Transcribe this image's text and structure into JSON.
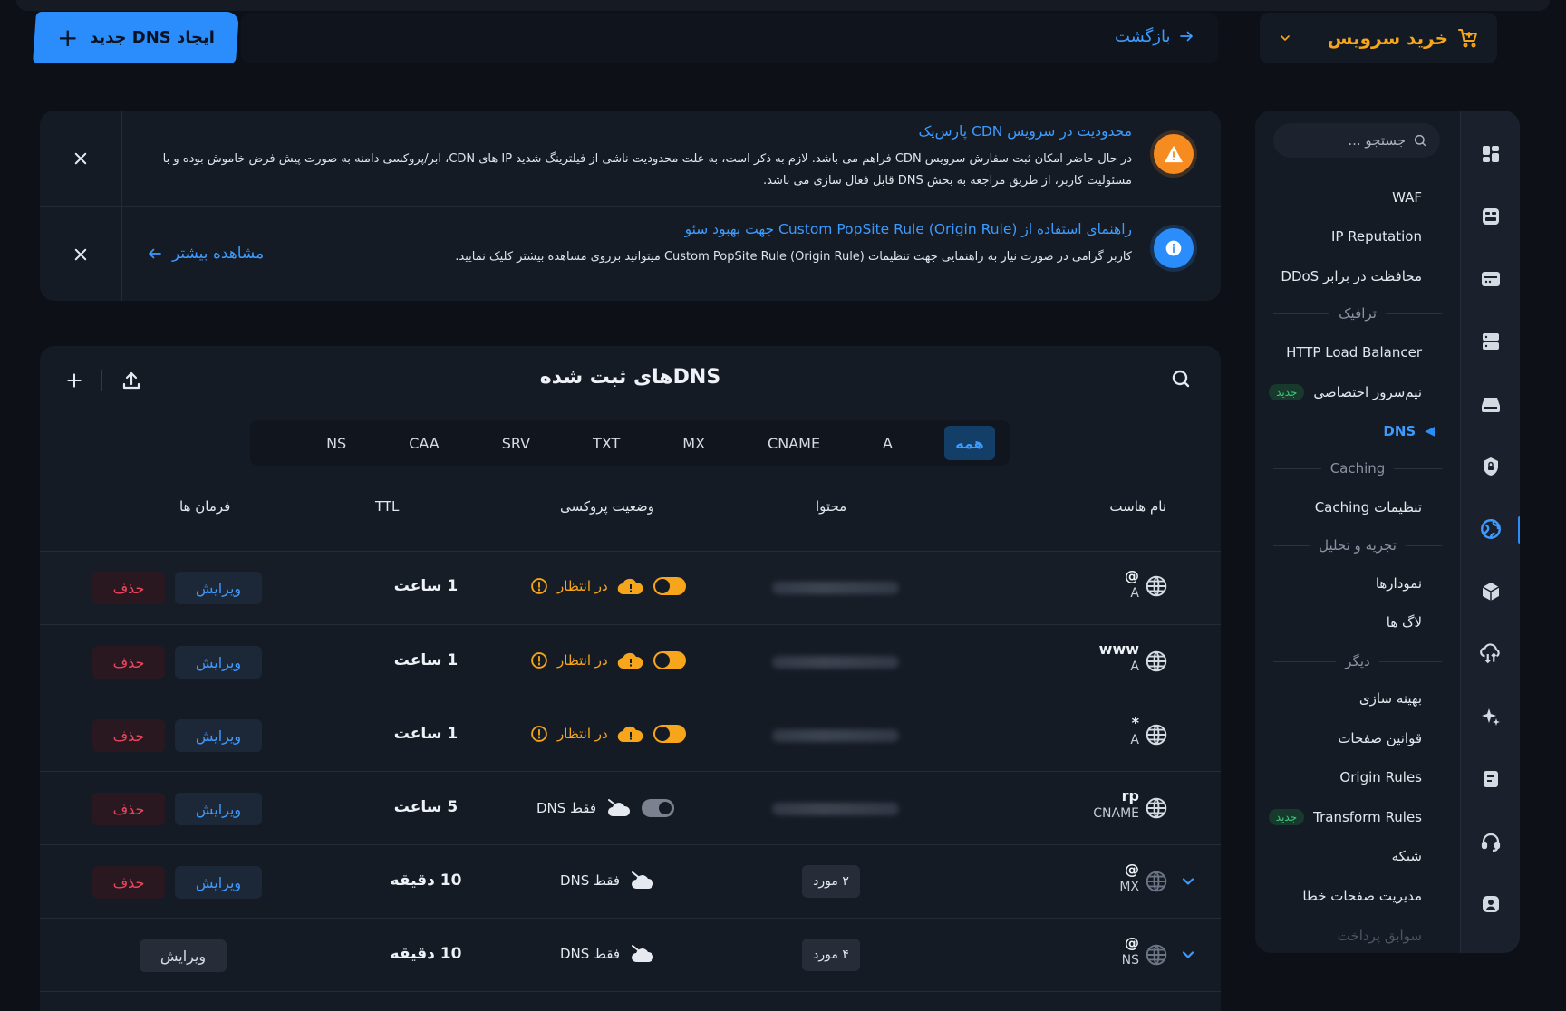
{
  "topbar": {
    "create_label": "ایجاد DNS جدید",
    "back_label": "بازگشت",
    "buy_label": "خرید سرویس"
  },
  "sidebar": {
    "search_placeholder": "جستجو ...",
    "items": {
      "waf": "WAF",
      "ip_reputation": "IP Reputation",
      "ddos": "محافظت در برابر DDoS",
      "http_lb": "HTTP Load Balancer",
      "private_ns": "نیم‌سرور اختصاصی",
      "dns": "DNS",
      "caching_settings": "تنظیمات Caching",
      "charts": "نمودارها",
      "logs": "لاگ ها",
      "optimization": "بهینه سازی",
      "page_rules": "قوانین صفحات",
      "origin_rules": "Origin Rules",
      "transform_rules": "Transform Rules",
      "network": "شبکه",
      "error_pages": "مدیریت صفحات خطا",
      "billing_history": "سوابق پرداخت"
    },
    "sections": {
      "traffic": "ترافیک",
      "caching": "Caching",
      "analytics": "تجزیه و تحلیل",
      "other": "دیگر"
    },
    "badge_new": "جدید"
  },
  "alerts": {
    "cdn_limit": {
      "title": "محدودیت در سرویس CDN پارس‌پک",
      "body": "در حال حاضر امکان ثبت سفارش سرویس CDN فراهم می باشد. لازم به ذکر است، به علت محدودیت ناشی از فیلترینگ شدید IP های CDN، ابر/پروکسی دامنه به صورت پیش فرض خاموش بوده و با مسئولیت کاربر، از طریق مراجعه به بخش DNS قابل فعال سازی می باشد."
    },
    "popsite_guide": {
      "title": "راهنمای استفاده از Custom PopSite Rule (Origin Rule) جهت بهبود سئو",
      "body": "کاربر گرامی در صورت نیاز به راهنمایی جهت تنظیمات Custom PopSite Rule (Origin Rule) میتوانید برروی مشاهده بیشتر کلیک نمایید.",
      "more_label": "مشاهده بیشتر"
    }
  },
  "dns_table": {
    "title": "DNSهای ثبت شده",
    "filters": [
      "همه",
      "A",
      "CNAME",
      "MX",
      "TXT",
      "SRV",
      "CAA",
      "NS"
    ],
    "active_filter": "همه",
    "headers": {
      "host": "نام هاست",
      "content": "محتوا",
      "proxy": "وضعیت پروکسی",
      "ttl": "TTL",
      "actions": "فرمان ها"
    },
    "edit_label": "ویرایش",
    "delete_label": "حذف",
    "rows": [
      {
        "host": "@",
        "type": "A",
        "proxy": "در انتظار",
        "ttl": "1 ساعت"
      },
      {
        "host": "www",
        "type": "A",
        "proxy": "در انتظار",
        "ttl": "1 ساعت"
      },
      {
        "host": "*",
        "type": "A",
        "proxy": "در انتظار",
        "ttl": "1 ساعت"
      },
      {
        "host": "rp",
        "type": "CNAME",
        "proxy": "فقط DNS",
        "ttl": "5 ساعت"
      },
      {
        "host": "@",
        "type": "MX",
        "content": "۲ مورد",
        "proxy": "فقط DNS",
        "ttl": "10 دقیقه"
      },
      {
        "host": "@",
        "type": "NS",
        "content": "۴ مورد",
        "proxy": "فقط DNS",
        "ttl": "10 دقیقه"
      }
    ]
  },
  "colors": {
    "accent": "#2a8dfb",
    "warning": "#f7a51b",
    "danger": "#f0455f",
    "background": "#0d1117",
    "card": "#151b24"
  }
}
